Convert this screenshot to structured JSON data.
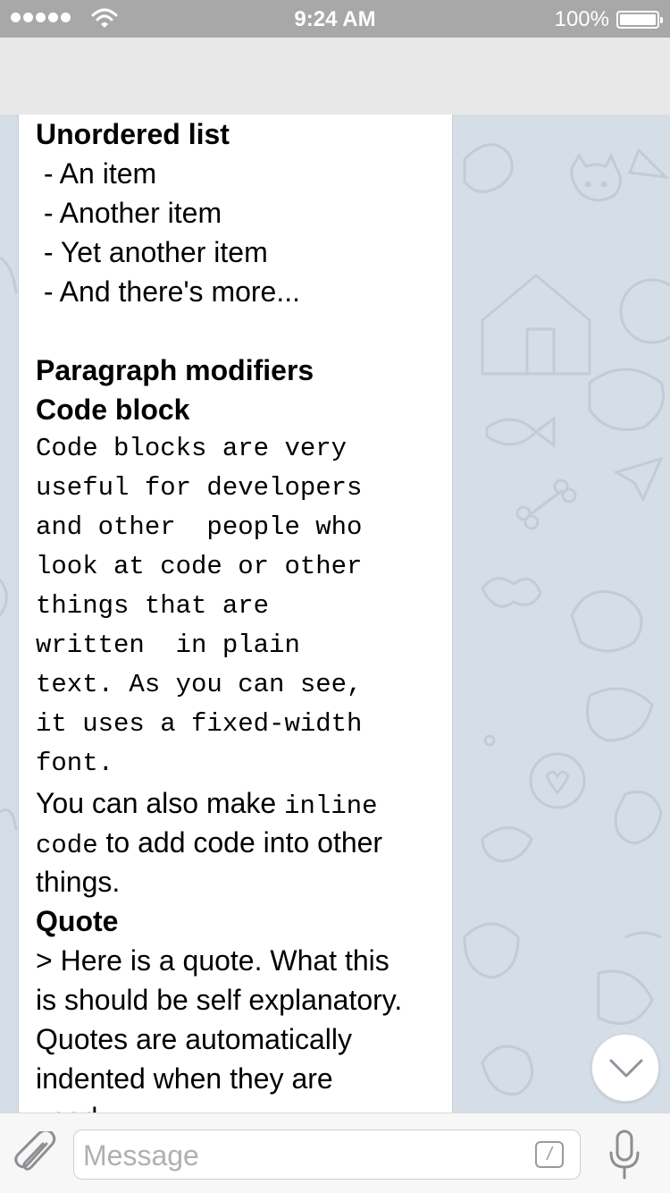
{
  "status_bar": {
    "time": "9:24 AM",
    "battery": "100%"
  },
  "message": {
    "lines": [
      {
        "text": "Unordered list",
        "style": "bold"
      },
      {
        "text": " - An item",
        "style": "normal"
      },
      {
        "text": " - Another item",
        "style": "normal"
      },
      {
        "text": " - Yet another item",
        "style": "normal"
      },
      {
        "text": " - And there's more...",
        "style": "normal"
      },
      {
        "text": "",
        "style": "blank"
      },
      {
        "text": "Paragraph modifiers",
        "style": "bold"
      },
      {
        "text": "Code block",
        "style": "bold"
      },
      {
        "text": "Code blocks are very",
        "style": "mono"
      },
      {
        "text": "useful for developers",
        "style": "mono"
      },
      {
        "text": "and other  people who",
        "style": "mono"
      },
      {
        "text": "look at code or other",
        "style": "mono"
      },
      {
        "text": "things that are",
        "style": "mono"
      },
      {
        "text": "written  in plain",
        "style": "mono"
      },
      {
        "text": "text. As you can see,",
        "style": "mono"
      },
      {
        "text": "it uses a fixed-width",
        "style": "mono"
      },
      {
        "text": "font.",
        "style": "mono"
      },
      {
        "text": "You can also make ",
        "style": "mixed",
        "inline_code": "inline"
      },
      {
        "text": " to add code into other",
        "style": "mixed-lead",
        "inline_code": "code"
      },
      {
        "text": "things.",
        "style": "normal"
      },
      {
        "text": "Quote",
        "style": "bold"
      },
      {
        "text": "> Here is a quote. What this",
        "style": "normal"
      },
      {
        "text": "is should be self explanatory.",
        "style": "normal"
      },
      {
        "text": "Quotes are automatically",
        "style": "normal"
      },
      {
        "text": "indented when they are",
        "style": "normal"
      },
      {
        "text": "used.",
        "style": "normal"
      }
    ]
  },
  "input": {
    "placeholder": "Message",
    "bot_command_glyph": "/"
  },
  "icons": {
    "attach": "paperclip-icon",
    "mic": "microphone-icon",
    "scroll_down": "chevron-down-icon",
    "wifi": "wifi-icon",
    "battery": "battery-icon",
    "bot_command": "slash-command-icon"
  },
  "colors": {
    "status_bar_bg": "#a8a8a8",
    "header_bg": "#e8e8e8",
    "wallpaper_bg": "#d5dde6",
    "bubble_bg": "#ffffff",
    "input_bar_bg": "#f7f7f7"
  }
}
